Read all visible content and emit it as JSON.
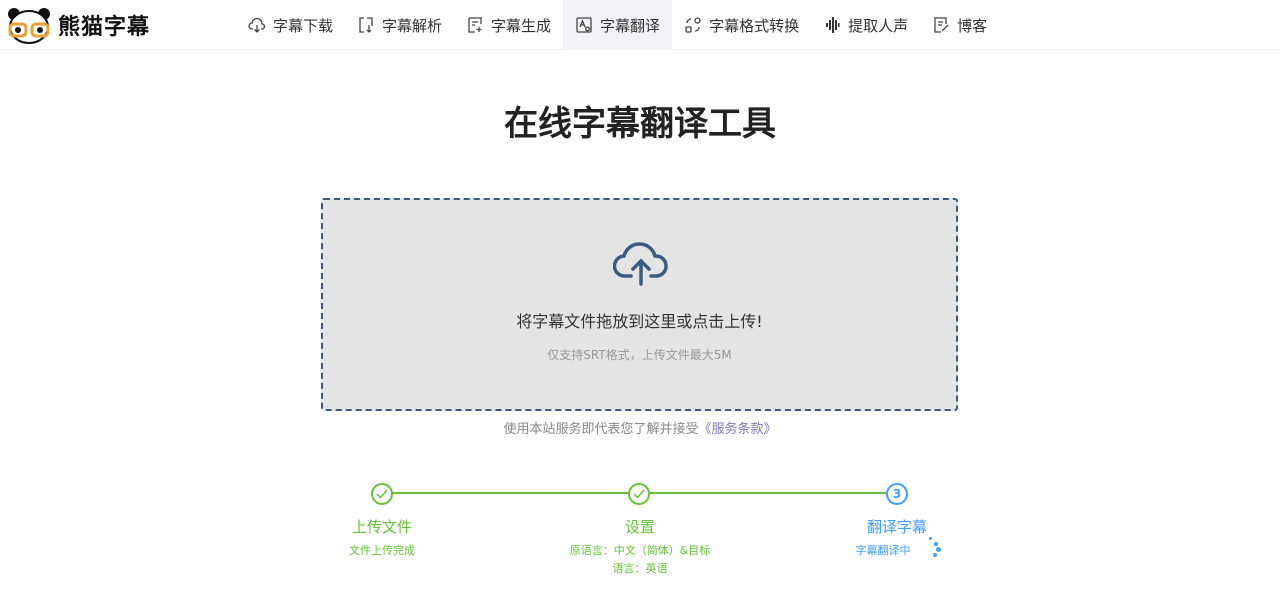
{
  "brand": {
    "name": "熊猫字幕"
  },
  "nav": [
    {
      "label": "字幕下载",
      "icon": "cloud-download-icon"
    },
    {
      "label": "字幕解析",
      "icon": "file-parse-icon"
    },
    {
      "label": "字幕生成",
      "icon": "subtitle-generate-icon"
    },
    {
      "label": "字幕翻译",
      "icon": "translate-icon",
      "active": true
    },
    {
      "label": "字幕格式转换",
      "icon": "format-convert-icon"
    },
    {
      "label": "提取人声",
      "icon": "waveform-icon"
    },
    {
      "label": "博客",
      "icon": "blog-edit-icon"
    }
  ],
  "page": {
    "title": "在线字幕翻译工具"
  },
  "upload": {
    "main": "将字幕文件拖放到这里或点击上传!",
    "sub": "仅支持SRT格式，上传文件最大5M",
    "icon": "cloud-upload-icon"
  },
  "terms": {
    "prefix": "使用本站服务即代表您了解并接受",
    "link": "《服务条款》"
  },
  "steps": [
    {
      "title": "上传文件",
      "desc": "文件上传完成",
      "status": "done"
    },
    {
      "title": "设置",
      "desc_line1": "原语言：中文（简体）&目标",
      "desc_line2": "语言：英语",
      "status": "done"
    },
    {
      "number": "3",
      "title": "翻译字幕",
      "desc": "字幕翻译中",
      "status": "in-progress"
    }
  ],
  "colors": {
    "success": "#67c23a",
    "active": "#409eff",
    "border": "#3d5a80"
  }
}
